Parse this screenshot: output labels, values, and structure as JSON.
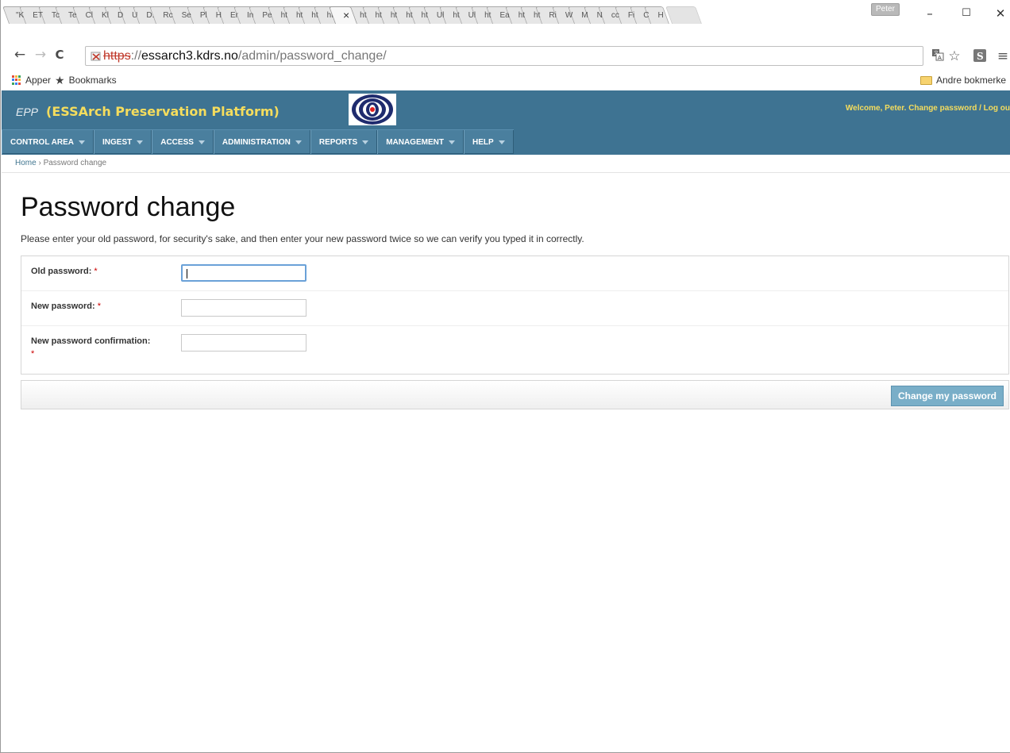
{
  "browser": {
    "tabs": [
      "\"K",
      "ET",
      "Tc",
      "Te",
      "Cl",
      "Kl",
      "D",
      "U",
      "D.",
      "Rc",
      "Se",
      "Pl",
      "H",
      "Er",
      "In",
      "Pe",
      "ht",
      "ht",
      "ht",
      "ht"
    ],
    "active_tab": "×",
    "tabs_after": [
      "ht",
      "ht",
      "ht",
      "ht",
      "ht",
      "Ul",
      "ht",
      "Ul",
      "ht",
      "Ea",
      "ht",
      "ht",
      "Ri",
      "W",
      "M",
      "N",
      "cc",
      "Fi",
      "C",
      "H"
    ],
    "profile": "Peter",
    "window_controls": {
      "minimize": "–",
      "maximize": "☐",
      "close": "✕"
    },
    "url_scheme": "https",
    "url_separator": "://",
    "url_host": "essarch3.kdrs.no",
    "url_path": "/admin/password_change/",
    "bookmarks": {
      "apps": "Apper",
      "bookmarks": "Bookmarks",
      "other": "Andre bokmerke"
    }
  },
  "header": {
    "short_name": "EPP",
    "site_name": "(ESSArch Preservation Platform)",
    "welcome": "Welcome, ",
    "user": "Peter",
    "change_password": "Change password",
    "separator": " / ",
    "logout": "Log ou"
  },
  "menu": [
    "CONTROL AREA",
    "INGEST",
    "ACCESS",
    "ADMINISTRATION",
    "REPORTS",
    "MANAGEMENT",
    "HELP"
  ],
  "breadcrumbs": {
    "home": "Home",
    "separator": " › ",
    "current": "Password change"
  },
  "page": {
    "title": "Password change",
    "intro": "Please enter your old password, for security's sake, and then enter your new password twice so we can verify you typed it in correctly."
  },
  "form": {
    "old_password": "Old password:",
    "new_password": "New password:",
    "new_password_confirmation": "New password confirmation:",
    "required_marker": "*",
    "submit": "Change my password"
  },
  "colors": {
    "header": "#3e7392",
    "brand_text": "#f5dd5d",
    "button": "#79aec8",
    "required": "#cc0000"
  }
}
